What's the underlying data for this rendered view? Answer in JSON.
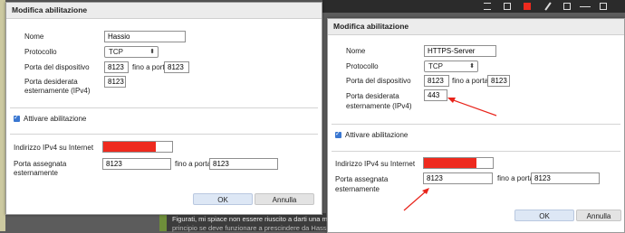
{
  "background_colors": {
    "desktop": "#5c5c5c",
    "chat": "#3c3c3c",
    "accent_red": "#ee2a1e",
    "check_blue": "#3a77d1"
  },
  "bg_text": {
    "line1": "Figurati, mi spiace non essere riuscito a darti una m",
    "line2": "principio se deve funzionare a prescindere da Hass"
  },
  "toolbar_icons": [
    "list-icon",
    "color-swatch-icon",
    "text-icon",
    "line-icon",
    "rect-icon",
    "red-swatch-icon",
    "pen-icon"
  ],
  "left_dialog": {
    "title": "Modifica abilitazione",
    "name_label": "Nome",
    "name_value": "Hassio",
    "protocol_label": "Protocollo",
    "protocol_value": "TCP",
    "device_port_label": "Porta del dispositivo",
    "device_port_from": "8123",
    "to_port_label": "fino a porta",
    "device_port_to": "8123",
    "external_port_label_line1": "Porta desiderata",
    "external_port_label_line2": "esternamente (IPv4)",
    "external_port_value": "8123",
    "enable_label": "Attivare abilitazione",
    "ipv4_label": "Indirizzo IPv4 su Internet",
    "assigned_port_label_line1": "Porta assegnata",
    "assigned_port_label_line2": "esternamente",
    "assigned_port_from": "8123",
    "assigned_to_label": "fino a porta",
    "assigned_port_to": "8123",
    "ok_label": "OK",
    "cancel_label": "Annulla"
  },
  "right_dialog": {
    "title": "Modifica abilitazione",
    "name_label": "Nome",
    "name_value": "HTTPS-Server",
    "protocol_label": "Protocollo",
    "protocol_value": "TCP",
    "device_port_label": "Porta del dispositivo",
    "device_port_from": "8123",
    "to_port_label": "fino a porta",
    "device_port_to": "8123",
    "external_port_label_line1": "Porta desiderata",
    "external_port_label_line2": "esternamente (IPv4)",
    "external_port_value": "443",
    "enable_label": "Attivare abilitazione",
    "ipv4_label": "Indirizzo IPv4 su Internet",
    "assigned_port_label_line1": "Porta assegnata",
    "assigned_port_label_line2": "esternamente",
    "assigned_port_from": "8123",
    "assigned_to_label": "fino a porta",
    "assigned_port_to": "8123",
    "ok_label": "OK",
    "cancel_label": "Annulla"
  }
}
